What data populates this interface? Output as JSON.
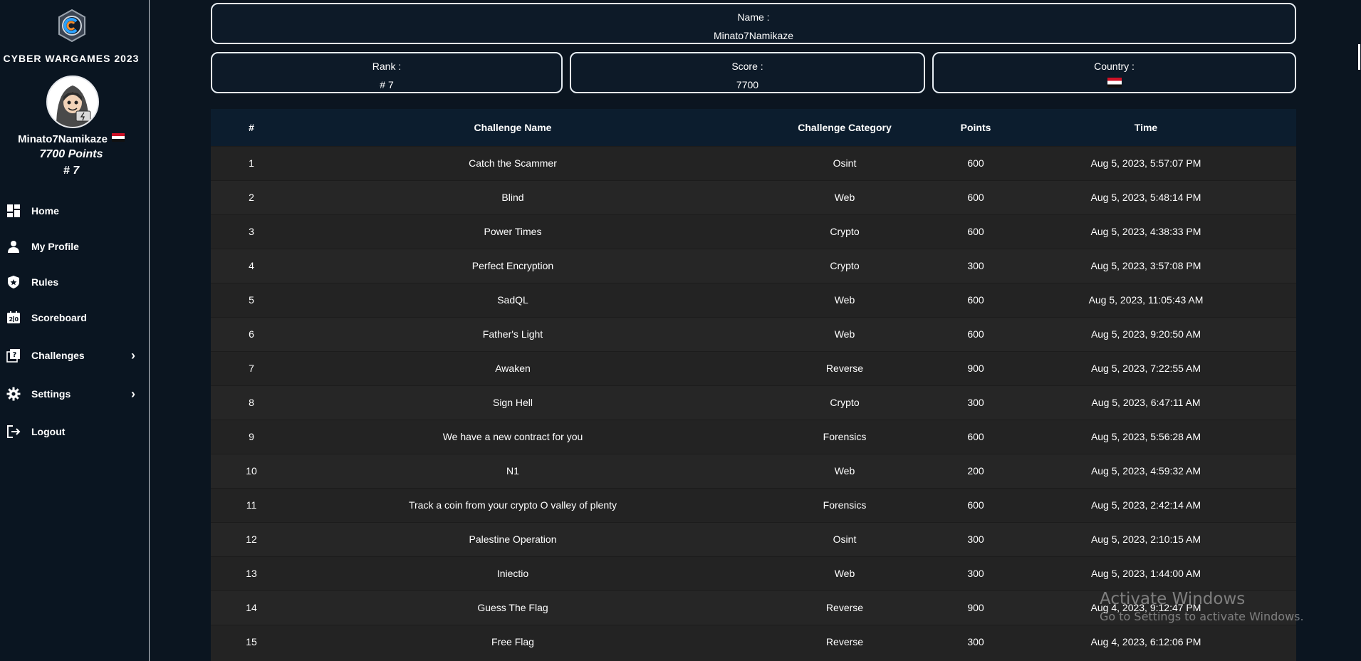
{
  "sidebar": {
    "brand": "CYBER WARGAMES 2023",
    "user": {
      "name": "Minato7Namikaze",
      "points": "7700 Points",
      "rank": "# 7"
    },
    "nav": [
      {
        "label": "Home",
        "icon": "dashboard-icon"
      },
      {
        "label": "My Profile",
        "icon": "person-icon"
      },
      {
        "label": "Rules",
        "icon": "shield-star-icon"
      },
      {
        "label": "Scoreboard",
        "icon": "scoreboard-icon"
      },
      {
        "label": "Challenges",
        "icon": "challenges-icon",
        "chevron": "›"
      },
      {
        "label": "Settings",
        "icon": "gear-icon",
        "chevron": "›"
      },
      {
        "label": "Logout",
        "icon": "logout-icon"
      }
    ]
  },
  "profile": {
    "name_label": "Name :",
    "name_value": "Minato7Namikaze",
    "rank_label": "Rank :",
    "rank_value": "# 7",
    "score_label": "Score :",
    "score_value": "7700",
    "country_label": "Country :",
    "country_flag": "egypt-flag"
  },
  "table": {
    "headers": [
      "#",
      "Challenge Name",
      "Challenge Category",
      "Points",
      "Time"
    ],
    "rows": [
      [
        "1",
        "Catch the Scammer",
        "Osint",
        "600",
        "Aug 5, 2023, 5:57:07 PM"
      ],
      [
        "2",
        "Blind",
        "Web",
        "600",
        "Aug 5, 2023, 5:48:14 PM"
      ],
      [
        "3",
        "Power Times",
        "Crypto",
        "600",
        "Aug 5, 2023, 4:38:33 PM"
      ],
      [
        "4",
        "Perfect Encryption",
        "Crypto",
        "300",
        "Aug 5, 2023, 3:57:08 PM"
      ],
      [
        "5",
        "SadQL",
        "Web",
        "600",
        "Aug 5, 2023, 11:05:43 AM"
      ],
      [
        "6",
        "Father's Light",
        "Web",
        "600",
        "Aug 5, 2023, 9:20:50 AM"
      ],
      [
        "7",
        "Awaken",
        "Reverse",
        "900",
        "Aug 5, 2023, 7:22:55 AM"
      ],
      [
        "8",
        "Sign Hell",
        "Crypto",
        "300",
        "Aug 5, 2023, 6:47:11 AM"
      ],
      [
        "9",
        "We have a new contract for you",
        "Forensics",
        "600",
        "Aug 5, 2023, 5:56:28 AM"
      ],
      [
        "10",
        "N1",
        "Web",
        "200",
        "Aug 5, 2023, 4:59:32 AM"
      ],
      [
        "11",
        "Track a coin from your crypto O valley of plenty",
        "Forensics",
        "600",
        "Aug 5, 2023, 2:42:14 AM"
      ],
      [
        "12",
        "Palestine Operation",
        "Osint",
        "300",
        "Aug 5, 2023, 2:10:15 AM"
      ],
      [
        "13",
        "Iniectio",
        "Web",
        "300",
        "Aug 5, 2023, 1:44:00 AM"
      ],
      [
        "14",
        "Guess The Flag",
        "Reverse",
        "900",
        "Aug 4, 2023, 9:12:47 PM"
      ],
      [
        "15",
        "Free Flag",
        "Reverse",
        "300",
        "Aug 4, 2023, 6:12:06 PM"
      ]
    ]
  },
  "watermark": {
    "title": "Activate Windows",
    "subtitle": "Go to Settings to activate Windows."
  }
}
